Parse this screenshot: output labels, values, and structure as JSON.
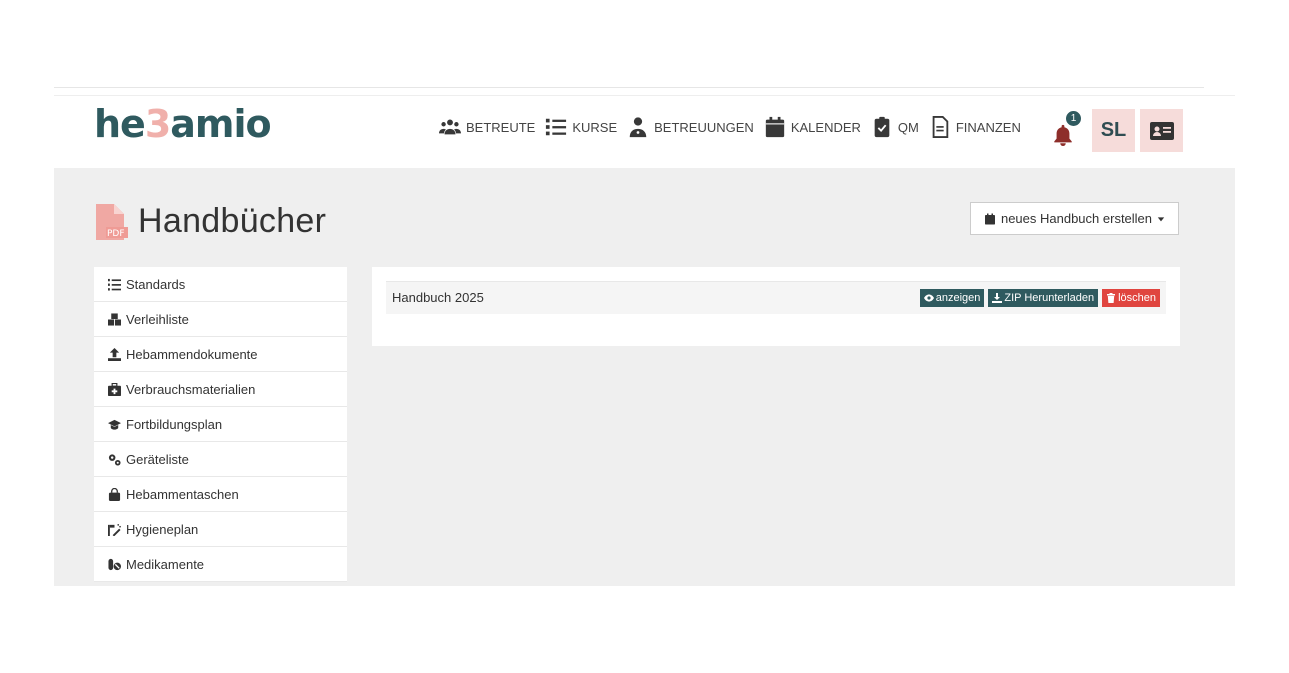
{
  "brand": {
    "logo_left": "he",
    "logo_mid": "3",
    "logo_right": "amio"
  },
  "nav": [
    {
      "label": "BETREUTE",
      "icon": "users-icon"
    },
    {
      "label": "KURSE",
      "icon": "list-icon"
    },
    {
      "label": "BETREUUNGEN",
      "icon": "user-doctor-icon"
    },
    {
      "label": "KALENDER",
      "icon": "calendar-icon"
    },
    {
      "label": "QM",
      "icon": "clipboard-check-icon"
    },
    {
      "label": "FINANZEN",
      "icon": "file-lines-icon"
    }
  ],
  "notifications": {
    "count": "1",
    "icon": "bell-icon"
  },
  "user": {
    "initials": "SL",
    "card_icon": "id-card-icon"
  },
  "page": {
    "title": "Handbücher",
    "title_icon": "pdf-file-icon"
  },
  "new_button": {
    "label": "neues Handbuch erstellen",
    "icon": "calendar-icon",
    "caret": "caret-down-icon"
  },
  "sidebar": {
    "items": [
      {
        "label": "Standards",
        "icon": "list-ol-icon"
      },
      {
        "label": "Verleihliste",
        "icon": "cubes-icon"
      },
      {
        "label": "Hebammendokumente",
        "icon": "upload-icon"
      },
      {
        "label": "Verbrauchsmaterialien",
        "icon": "kit-medical-icon"
      },
      {
        "label": "Fortbildungsplan",
        "icon": "graduation-cap-icon"
      },
      {
        "label": "Geräteliste",
        "icon": "gears-icon"
      },
      {
        "label": "Hebammentaschen",
        "icon": "bag-icon"
      },
      {
        "label": "Hygieneplan",
        "icon": "spray-icon"
      },
      {
        "label": "Medikamente",
        "icon": "pills-icon"
      }
    ]
  },
  "handbooks": [
    {
      "name": "Handbuch 2025",
      "actions": {
        "view": "anzeigen",
        "download": "ZIP Herunterladen",
        "delete": "löschen"
      }
    }
  ],
  "colors": {
    "accent": "#2f5a5f",
    "pink": "#f6dcda",
    "danger": "#e0453f",
    "bell": "#8e2e2a"
  }
}
